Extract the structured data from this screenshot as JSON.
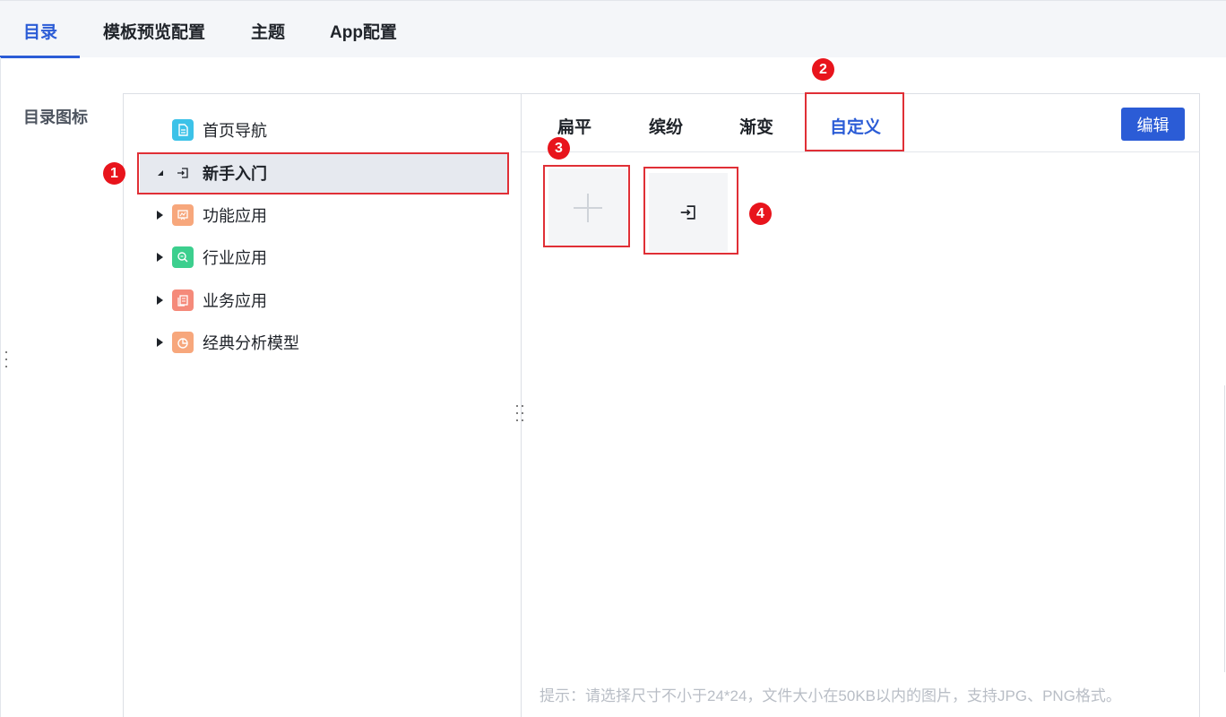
{
  "top_tabs": [
    {
      "label": "目录",
      "active": true
    },
    {
      "label": "模板预览配置",
      "active": false
    },
    {
      "label": "主题",
      "active": false
    },
    {
      "label": "App配置",
      "active": false
    }
  ],
  "section_label": "目录图标",
  "tree": {
    "items": [
      {
        "label": "首页导航",
        "icon": "document-icon",
        "color": "#3cc2e8",
        "expandable": false
      },
      {
        "label": "新手入门",
        "icon": "enter-icon",
        "color": "#ffffff",
        "expandable": true,
        "expanded": true,
        "selected": true
      },
      {
        "label": "功能应用",
        "icon": "presentation-icon",
        "color": "#f7a77c",
        "expandable": true
      },
      {
        "label": "行业应用",
        "icon": "search-icon",
        "color": "#3ccf8e",
        "expandable": true
      },
      {
        "label": "业务应用",
        "icon": "files-icon",
        "color": "#f58a7a",
        "expandable": true
      },
      {
        "label": "经典分析模型",
        "icon": "pie-chart-icon",
        "color": "#f7a77c",
        "expandable": true
      }
    ]
  },
  "icon_tabs": [
    {
      "label": "扁平",
      "active": false
    },
    {
      "label": "缤纷",
      "active": false
    },
    {
      "label": "渐变",
      "active": false
    },
    {
      "label": "自定义",
      "active": true
    }
  ],
  "edit_button": "编辑",
  "hint": "提示：请选择尺寸不小于24*24，文件大小在50KB以内的图片，支持JPG、PNG格式。",
  "badges": [
    "1",
    "2",
    "3",
    "4"
  ],
  "colors": {
    "accent": "#2b5cd6",
    "annotation": "#e02f36"
  }
}
